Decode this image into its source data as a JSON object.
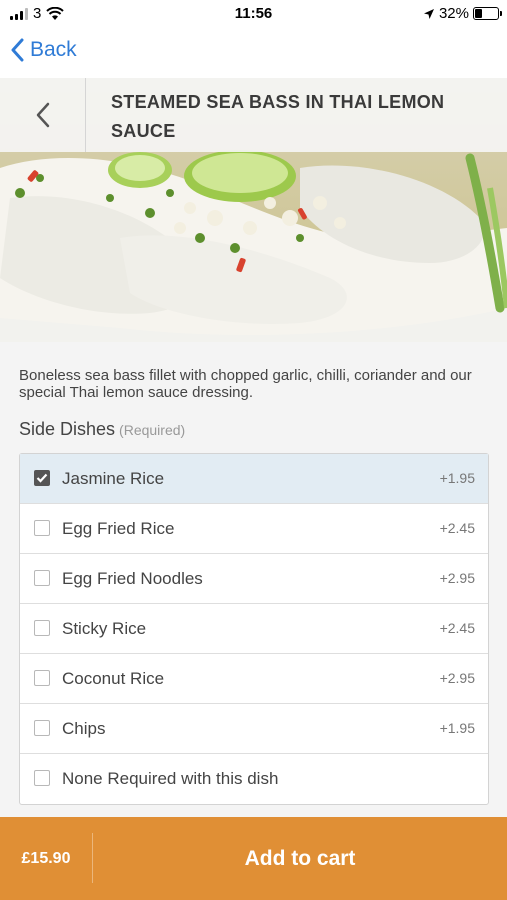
{
  "status_bar": {
    "carrier": "3",
    "time": "11:56",
    "battery": "32%"
  },
  "nav": {
    "back_label": "Back"
  },
  "dish": {
    "title": "STEAMED SEA BASS IN THAI LEMON SAUCE",
    "description": "Boneless sea bass fillet with chopped garlic, chilli, coriander and our special Thai lemon sauce dressing."
  },
  "side_dishes": {
    "title": "Side Dishes",
    "required_note": "(Required)",
    "options": [
      {
        "label": "Jasmine Rice",
        "price": "+1.95",
        "selected": true
      },
      {
        "label": "Egg Fried Rice",
        "price": "+2.45",
        "selected": false
      },
      {
        "label": "Egg Fried Noodles",
        "price": "+2.95",
        "selected": false
      },
      {
        "label": "Sticky Rice",
        "price": "+2.45",
        "selected": false
      },
      {
        "label": "Coconut Rice",
        "price": "+2.95",
        "selected": false
      },
      {
        "label": "Chips",
        "price": "+1.95",
        "selected": false
      },
      {
        "label": "None Required with this dish",
        "price": "",
        "selected": false
      }
    ]
  },
  "footer": {
    "price": "£15.90",
    "add_to_cart_label": "Add to cart"
  },
  "colors": {
    "accent": "#e08f35",
    "link": "#2f7bd6",
    "selected_row": "#e2ecf3"
  }
}
